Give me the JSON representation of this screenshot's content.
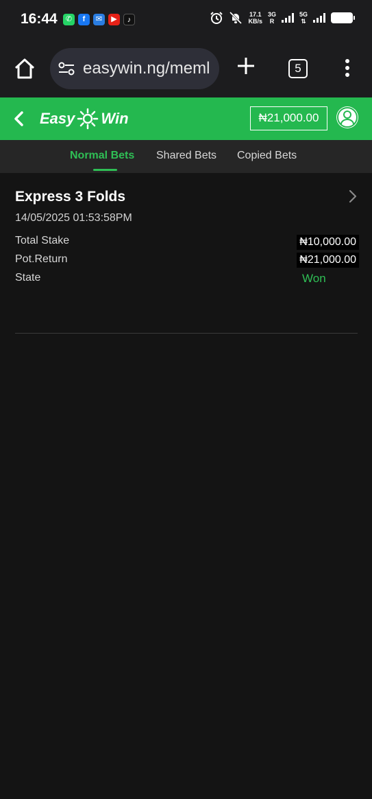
{
  "status_bar": {
    "time": "16:44",
    "net_speed_value": "17.1",
    "net_speed_unit": "KB/s",
    "sim1_label": "3G",
    "sim1_sub": "R",
    "sim2_label": "5G",
    "app_icons": [
      "whatsapp-icon",
      "facebook-icon",
      "message-app-icon",
      "youtube-icon",
      "tiktok-icon"
    ]
  },
  "browser": {
    "url": "easywin.ng/meml",
    "tab_count": "5"
  },
  "header": {
    "logo_left": "Easy",
    "logo_right": "Win",
    "balance": "₦21,000.00",
    "brand_color": "#24b84f"
  },
  "tabs": [
    {
      "label": "Normal Bets",
      "active": true
    },
    {
      "label": "Shared Bets",
      "active": false
    },
    {
      "label": "Copied Bets",
      "active": false
    }
  ],
  "bet": {
    "title": "Express 3 Folds",
    "datetime": "14/05/2025 01:53:58PM",
    "rows": [
      {
        "label": "Total Stake",
        "value": "₦10,000.00"
      },
      {
        "label": "Pot.Return",
        "value": "₦21,000.00"
      },
      {
        "label": "State",
        "value": "Won"
      }
    ],
    "status_color": "#2fbf55"
  }
}
